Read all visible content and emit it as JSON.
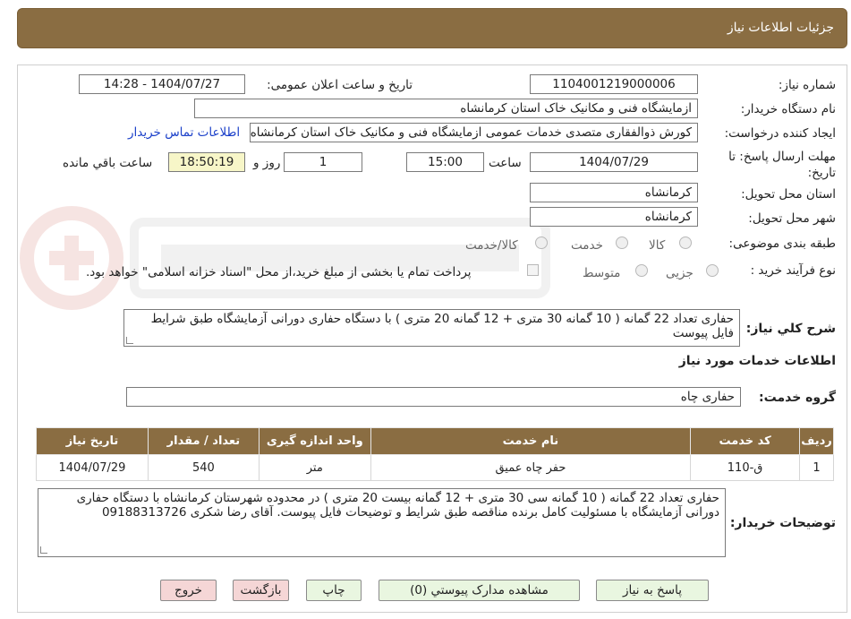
{
  "header": {
    "title": "جزئیات اطلاعات نیاز"
  },
  "form": {
    "need_number_label": "شماره نیاز:",
    "need_number": "1104001219000006",
    "announce_label": "تاریخ و ساعت اعلان عمومی:",
    "announce_value": "1404/07/27 - 14:28",
    "buyer_org_label": "نام دستگاه خریدار:",
    "buyer_org": "ازمایشگاه فنی و مکانیک خاک استان کرمانشاه",
    "creator_label": "ایجاد کننده درخواست:",
    "creator": "کورش ذوالفقاری متصدی خدمات عمومی ازمایشگاه فنی و مکانیک خاک استان کرمانشاه",
    "contact_link": "اطلاعات تماس خریدار",
    "deadline_label": "مهلت ارسال پاسخ: تا تاریخ:",
    "deadline_date": "1404/07/29",
    "time_label": "ساعت",
    "deadline_time": "15:00",
    "days_value": "1",
    "days_label": "روز و",
    "remaining_time": "18:50:19",
    "remaining_label": "ساعت باقي مانده",
    "province_label": "استان محل تحویل:",
    "province": "کرمانشاه",
    "city_label": "شهر محل تحویل:",
    "city": "کرمانشاه",
    "category_label": "طبقه بندی موضوعی:",
    "category_options": [
      "کالا",
      "خدمت",
      "کالا/خدمت"
    ],
    "process_label": "نوع فرآیند خرید :",
    "process_options": [
      "جزیی",
      "متوسط"
    ],
    "payment_note": "پرداخت تمام یا بخشی از مبلغ خرید،از محل \"اسناد خزانه اسلامی\" خواهد بود."
  },
  "summary": {
    "label": "شرح كلي نياز:",
    "text": "حفاری تعداد 22 گمانه ( 10 گمانه 30 متری + 12 گمانه 20 متری ) با دستگاه حفاری دورانی آزمایشگاه طبق شرایط فایل پیوست"
  },
  "services": {
    "section_title": "اطلاعات خدمات مورد نیاز",
    "group_label": "گروه خدمت:",
    "group_value": "حفاری چاه",
    "columns": [
      "ردیف",
      "کد خدمت",
      "نام خدمت",
      "واحد اندازه گیری",
      "تعداد / مقدار",
      "تاریخ نیاز"
    ],
    "rows": [
      [
        "1",
        "ق-110",
        "حفر چاه عمیق",
        "متر",
        "540",
        "1404/07/29"
      ]
    ]
  },
  "buyer_notes": {
    "label": "توضیحات خریدار:",
    "text": "حفاری تعداد 22 گمانه ( 10 گمانه سی 30 متری + 12 گمانه بیست 20 متری ) در محدوده شهرستان کرمانشاه با دستگاه حفاری دورانی آزمایشگاه با مسئولیت کامل برنده مناقصه طبق شرایط و توضیحات فایل پیوست. آقای رضا شکری 09188313726"
  },
  "buttons": {
    "reply": "پاسخ به نیاز",
    "attachments": "مشاهده مدارک پیوستي (0)",
    "print": "چاپ",
    "back": "بازگشت",
    "exit": "خروج"
  },
  "colors": {
    "accent": "#8a6d42",
    "button_green": "#e9f6e0",
    "button_pink": "#f5d6d6",
    "link": "#1a3fc9"
  }
}
